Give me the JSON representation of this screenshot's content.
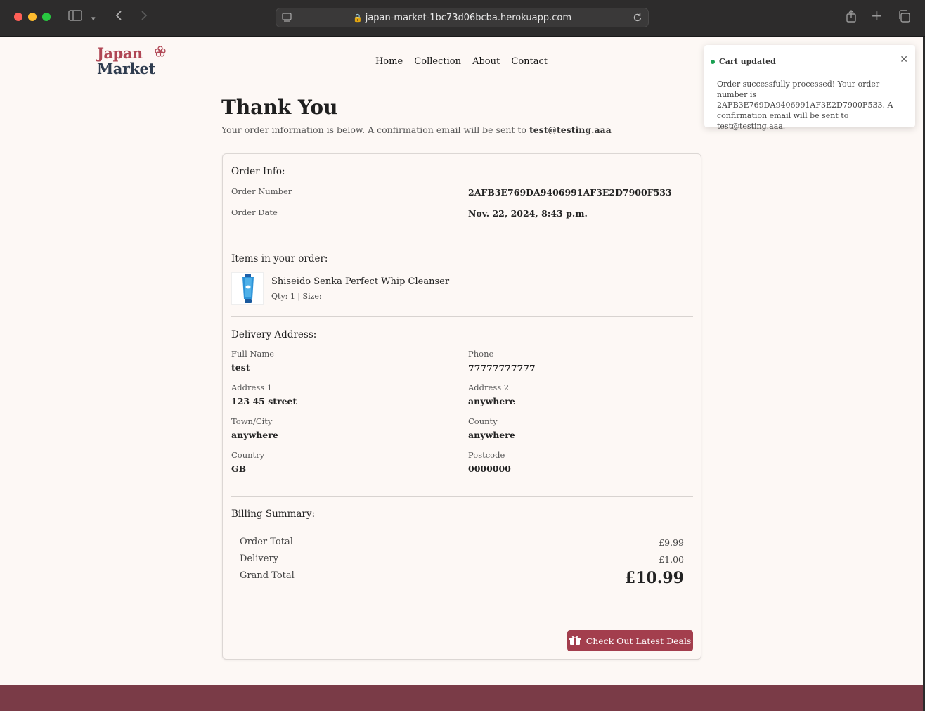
{
  "browser": {
    "url": "japan-market-1bc73d06bcba.herokuapp.com"
  },
  "logo": {
    "line1": "Japan",
    "line2": "Market"
  },
  "nav": [
    "Home",
    "Collection",
    "About",
    "Contact"
  ],
  "heading": "Thank You",
  "subtitle": {
    "text": "Your order information is below. A confirmation email will be sent to",
    "email": "test@testing.aaa"
  },
  "order_info": {
    "title": "Order Info:",
    "number_label": "Order Number",
    "number": "2AFB3E769DA9406991AF3E2D7900F533",
    "date_label": "Order Date",
    "date": "Nov. 22, 2024, 8:43 p.m."
  },
  "items": {
    "title": "Items in your order:",
    "list": [
      {
        "name": "Shiseido Senka Perfect Whip Cleanser",
        "meta": "Qty: 1 | Size:"
      }
    ]
  },
  "delivery": {
    "title": "Delivery Address:",
    "fields": [
      {
        "label": "Full Name",
        "value": "test"
      },
      {
        "label": "Phone",
        "value": "77777777777"
      },
      {
        "label": "Address 1",
        "value": "123 45 street"
      },
      {
        "label": "Address 2",
        "value": "anywhere"
      },
      {
        "label": "Town/City",
        "value": "anywhere"
      },
      {
        "label": "County",
        "value": "anywhere"
      },
      {
        "label": "Country",
        "value": "GB"
      },
      {
        "label": "Postcode",
        "value": "0000000"
      }
    ]
  },
  "billing": {
    "title": "Billing Summary:",
    "order_total_label": "Order Total",
    "order_total": "£9.99",
    "delivery_label": "Delivery",
    "delivery": "£1.00",
    "grand_total_label": "Grand Total",
    "grand_total": "£10.99"
  },
  "deals_button": "Check Out Latest Deals",
  "toast": {
    "title": "Cart updated",
    "body": "Order successfully processed! Your order number is 2AFB3E769DA9406991AF3E2D7900F533. A confirmation email will be sent to test@testing.aaa."
  },
  "colors": {
    "accent": "#a33e4d",
    "footer": "#7a3b47",
    "success": "#1aa053"
  }
}
